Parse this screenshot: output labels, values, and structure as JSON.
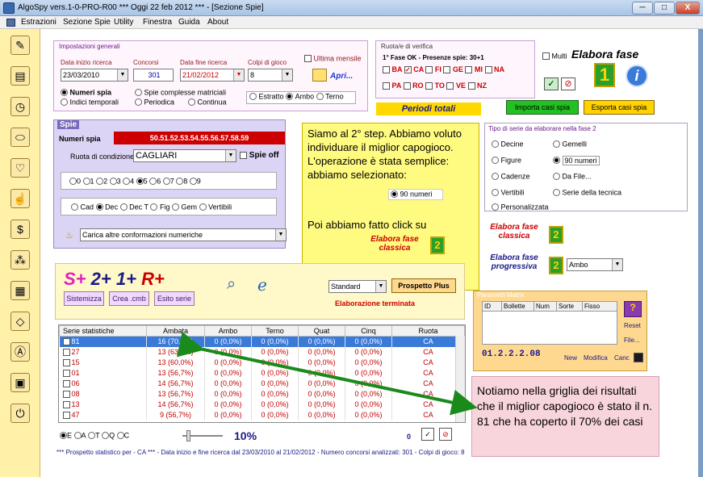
{
  "window": {
    "title": "AlgoSpy vers.1-0-PRO-R00  ***  Oggi 22 feb 2012  ***  - [Sezione Spie]",
    "btn_min": "─",
    "btn_max": "□",
    "btn_close": "X"
  },
  "menu": [
    "Estrazioni",
    "Sezione Spie",
    "Utility",
    "Finestra",
    "Guida",
    "About"
  ],
  "sidebar_icons": [
    "pencil-icon",
    "book-icon",
    "clock-icon",
    "pill-icon",
    "bulb-icon",
    "hand-icon",
    "dollar-icon",
    "tree-icon",
    "grid-icon",
    "diamond-icon",
    "alert-icon",
    "card-icon",
    "power-icon"
  ],
  "settings": {
    "legend": "Impostazioni generali",
    "start_label": "Data inizio ricerca",
    "start_value": "23/03/2010",
    "contests_label": "Concorsi",
    "contests_value": "301",
    "end_label": "Data fine ricerca",
    "end_value": "21/02/2012",
    "hits_label": "Colpi di gioco",
    "hits_value": "8",
    "monthly_label": "Ultima mensile",
    "open_label": "Apri...",
    "radio1": [
      "Numeri spia",
      "Indici temporali"
    ],
    "radio2": [
      "Spie complesse matriciali",
      "Periodica",
      "Continua"
    ],
    "radio3": [
      "Estratto",
      "Ambo",
      "Terno"
    ]
  },
  "wheels": {
    "legend": "Ruota/e di verifica",
    "phase": "1° Fase OK - Presenze spie: 30+1",
    "row1": [
      "BA",
      "CA",
      "FI",
      "GE",
      "MI",
      "NA"
    ],
    "row2": [
      "PA",
      "RO",
      "TO",
      "VE",
      "NZ"
    ],
    "multi": "Multi"
  },
  "elabora": {
    "title": "Elabora fase",
    "digit": "1",
    "info": "i"
  },
  "periodi": "Periodi totali",
  "import_btn": "Importa casi spia",
  "export_btn": "Esporta casi spia",
  "spie": {
    "legend": "Spie",
    "numeri_label": "Numeri spia",
    "numeri_value": "50.51.52.53.54.55.56.57.58.59",
    "ruota_label": "Ruota di condizione",
    "ruota_value": "CAGLIARI",
    "spie_off": "Spie off",
    "digits": [
      "0",
      "1",
      "2",
      "3",
      "4",
      "5",
      "6",
      "7",
      "8",
      "9"
    ],
    "types": [
      "Cad",
      "Dec",
      "Dec T",
      "Fig",
      "Gem",
      "Vertibili"
    ],
    "conf": "Carica altre conformazioni numeriche"
  },
  "callout1": {
    "text": "Siamo al 2° step. Abbiamo voluto individuare il miglior capogioco. L'operazione è stata semplice: abbiamo selezionato:",
    "radio": "90 numeri",
    "text2": "Poi abbiamo fatto click su",
    "btn": "Elabora fase classica",
    "digit": "2"
  },
  "series_type": {
    "legend": "Tipo di serie da elaborare nella fase 2",
    "items": [
      "Decine",
      "Gemelli",
      "Figure",
      "90 numeri",
      "Cadenze",
      "Da File...",
      "Vertibili",
      "Serie della tecnica",
      "Personalizzata"
    ]
  },
  "fase_classica": "Elabora fase classica",
  "fase_progressiva": "Elabora fase progressiva",
  "fase_digit": "2",
  "ambo_select": "Ambo",
  "toolbar2": {
    "title_s": "S+",
    "title_2": "2+",
    "title_1": "1+",
    "title_r": "R+",
    "btn1": "Sistemizza",
    "btn2": "Crea .cmb",
    "btn3": "Esito serie",
    "standard": "Standard",
    "prospetto": "Prospetto Plus",
    "status": "Elaborazione terminata"
  },
  "matrix": {
    "legend": "Parametri Matrix",
    "cols": [
      "ID",
      "Bollette",
      "Num",
      "Sorte",
      "Fisso"
    ],
    "reset": "Reset",
    "file": "File...",
    "code": "01.2.2.2.08",
    "new": "New",
    "modify": "Modifica",
    "cancel": "Canc"
  },
  "grid": {
    "cols": [
      "Serie statistiche",
      "Ambata",
      "Ambo",
      "Terno",
      "Quat",
      "Cinq",
      "Ruota"
    ],
    "rows": [
      [
        "81",
        "16 (70,0%)",
        "0 (0,0%)",
        "0 (0,0%)",
        "0 (0,0%)",
        "0 (0,0%)",
        "CA"
      ],
      [
        "27",
        "13 (63,3%)",
        "0 (0,0%)",
        "0 (0,0%)",
        "0 (0,0%)",
        "0 (0,0%)",
        "CA"
      ],
      [
        "15",
        "13 (60,0%)",
        "0 (0,0%)",
        "0 (0,0%)",
        "0 (0,0%)",
        "0 (0,0%)",
        "CA"
      ],
      [
        "01",
        "13 (56,7%)",
        "0 (0,0%)",
        "0 (0,0%)",
        "0 (0,0%)",
        "0 (0,0%)",
        "CA"
      ],
      [
        "06",
        "14 (56,7%)",
        "0 (0,0%)",
        "0 (0,0%)",
        "0 (0,0%)",
        "0 (0,0%)",
        "CA"
      ],
      [
        "08",
        "13 (56,7%)",
        "0 (0,0%)",
        "0 (0,0%)",
        "0 (0,0%)",
        "0 (0,0%)",
        "CA"
      ],
      [
        "13",
        "14 (56,7%)",
        "0 (0,0%)",
        "0 (0,0%)",
        "0 (0,0%)",
        "0 (0,0%)",
        "CA"
      ],
      [
        "47",
        "9 (56,7%)",
        "0 (0,0%)",
        "0 (0,0%)",
        "0 (0,0%)",
        "0 (0,0%)",
        "CA"
      ]
    ]
  },
  "bottom": {
    "radios": [
      "E",
      "A",
      "T",
      "Q",
      "C"
    ],
    "pct": "10%",
    "count": "0",
    "note": "*** Prospetto statistico per  - CA ***  - Data inizio e fine ricerca dal 23/03/2010 al 21/02/2012 - Numero concorsi analizzati: 301 - Colpi di gioco: 8"
  },
  "callout2": "Notiamo nella griglia dei risultati che il miglior capogioco è stato il n. 81 che ha coperto il 70% dei casi"
}
